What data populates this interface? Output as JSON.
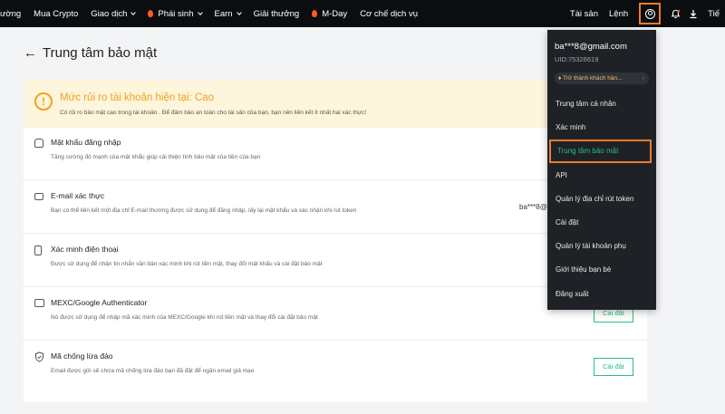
{
  "nav": {
    "items": [
      {
        "label": "ường",
        "chevron": false,
        "fire": false
      },
      {
        "label": "Mua Crypto",
        "chevron": false,
        "fire": false
      },
      {
        "label": "Giao dịch",
        "chevron": true,
        "fire": false
      },
      {
        "label": "Phái sinh",
        "chevron": true,
        "fire": true
      },
      {
        "label": "Earn",
        "chevron": true,
        "fire": false
      },
      {
        "label": "Giải thưởng",
        "chevron": false,
        "fire": false
      },
      {
        "label": "M-Day",
        "chevron": false,
        "fire": true
      },
      {
        "label": "Cơ chế dịch vụ",
        "chevron": false,
        "fire": false
      }
    ],
    "assets": "Tài sản",
    "orders": "Lệnh",
    "right_cut": "Tiế",
    "colors": {
      "bg": "#0b0e11",
      "fire": "#ff5a1f",
      "highlight": "#f07b2a"
    }
  },
  "page": {
    "back_arrow": "←",
    "title": "Trung tâm bảo mật"
  },
  "risk": {
    "icon": "!",
    "title": "Mức rủi ro tài khoản hiện tại: Cao",
    "desc": "Có rủi ro bảo mật cao trong tài khoản . Để đảm bảo an toàn cho tài sản của bạn, bạn nên liên kết ít nhất hai xác thực!",
    "color": "#f0a21b"
  },
  "rows": [
    {
      "icon": "lock-icon",
      "title": "Mật khẩu đăng nhập",
      "desc": "Tăng cường độ mạnh của mật khẩu giúp cải thiện tính bảo mật của tiền của bạn"
    },
    {
      "icon": "email-icon",
      "title": "E-mail xác thực",
      "desc": "Bạn có thể liên kết một địa chỉ E-mail thường được sử dụng để đăng nhập, lấy lại mật khẩu và xác nhận khi rút token",
      "value": "ba***8@"
    },
    {
      "icon": "phone-icon",
      "title": "Xác minh điện thoại",
      "desc": "Được sử dụng để nhận tin nhắn văn bản xác minh khi rút tiền mặt, thay đổi mật khẩu và cài đặt bảo mật"
    },
    {
      "icon": "authenticator-icon",
      "title": "MEXC/Google Authenticator",
      "desc": "Nó được sử dụng để nhập mã xác minh của MEXC/Google khi rút tiền mặt và thay đổi cài đặt bảo mật",
      "button": "Cài đặt"
    },
    {
      "icon": "shield-icon",
      "title": "Mã chống lừa đảo",
      "desc": "Email được gửi sẽ chứa mã chống lừa đảo bạn đã đặt để ngăn email giả mạo",
      "button": "Cài đặt"
    }
  ],
  "dropdown": {
    "email": "ba***8@gmail.com",
    "uid": "UID:75326619",
    "vip": "Trở thành khách hàn...",
    "items": [
      {
        "label": "Trung tâm cá nhân",
        "active": false
      },
      {
        "label": "Xác minh",
        "active": false
      },
      {
        "label": "Trung tâm bảo mật",
        "active": true
      },
      {
        "label": "API",
        "active": false
      },
      {
        "label": "Quản lý địa chỉ rút token",
        "active": false
      },
      {
        "label": "Cài đặt",
        "active": false
      },
      {
        "label": "Quản lý tài khoản phụ",
        "active": false
      },
      {
        "label": "Giới thiệu bạn bè",
        "active": false
      },
      {
        "label": "Đăng xuất",
        "active": false
      }
    ],
    "accent": "#2bbd7e"
  }
}
